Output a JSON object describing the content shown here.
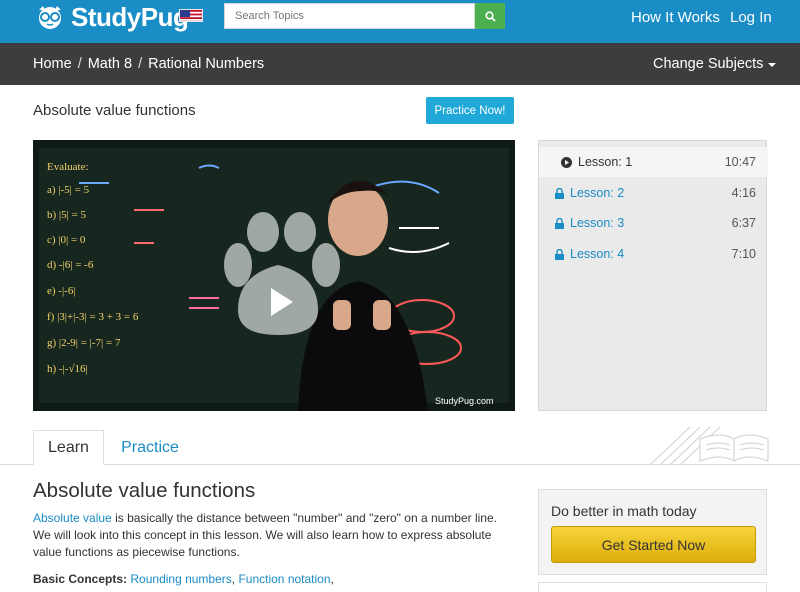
{
  "header": {
    "brand": "StudyPug",
    "search_placeholder": "Search Topics",
    "nav": [
      "How It Works",
      "Log In"
    ]
  },
  "breadcrumb": [
    "Home",
    "Math 8",
    "Rational Numbers"
  ],
  "change_subjects": "Change Subjects",
  "page_title": "Absolute value functions",
  "practice_button": "Practice Now!",
  "video": {
    "watermark": "StudyPug.com",
    "board_lines": [
      "Evaluate:",
      "a) |-5| = 5",
      "b) |5| = 5",
      "c) |0| = 0",
      "d) -|6| = -6",
      "e) -|-6|",
      "f) |3|+|-3| = 3 + 3 = 6",
      "g) |2-9| = |-7| = 7",
      "h) -|-√16|"
    ]
  },
  "lessons": [
    {
      "label": "Lesson: 1",
      "time": "10:47",
      "state": "playing"
    },
    {
      "label": "Lesson: 2",
      "time": "4:16",
      "state": "locked"
    },
    {
      "label": "Lesson: 3",
      "time": "6:37",
      "state": "locked"
    },
    {
      "label": "Lesson: 4",
      "time": "7:10",
      "state": "locked"
    }
  ],
  "tabs": [
    "Learn",
    "Practice"
  ],
  "content": {
    "heading": "Absolute value functions",
    "link": "Absolute value",
    "text": " is basically the distance between \"number\" and \"zero\" on a number line. We will look into this concept in this lesson. We will also learn how to express absolute value functions as piecewise functions.",
    "basics_label": "Basic Concepts:",
    "basics_links": [
      "Rounding numbers",
      "Function notation"
    ]
  },
  "cta": {
    "title": "Do better in math today",
    "button": "Get Started Now"
  },
  "colors": {
    "header_blue": "#1a8cc6",
    "crumb_bar": "#3d3d3d",
    "search_green": "#4caf50",
    "practice_btn": "#20a8d8",
    "cta_gold": "#f2c61f"
  }
}
